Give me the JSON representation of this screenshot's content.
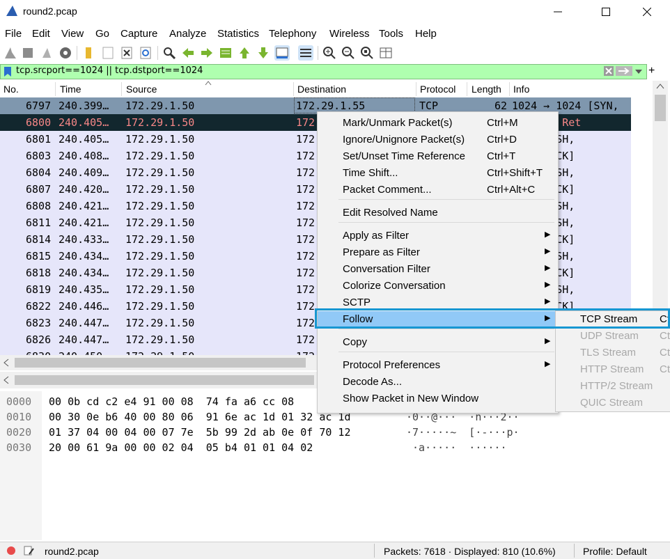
{
  "window": {
    "title": "round2.pcap"
  },
  "menu": [
    "File",
    "Edit",
    "View",
    "Go",
    "Capture",
    "Analyze",
    "Statistics",
    "Telephony",
    "Wireless",
    "Tools",
    "Help"
  ],
  "filter": {
    "value": "tcp.srcport==1024 || tcp.dstport==1024"
  },
  "columns": [
    "No.",
    "Time",
    "Source",
    "Destination",
    "Protocol",
    "Length",
    "Info"
  ],
  "packets": [
    {
      "no": "6797",
      "time": "240.399…",
      "src": "172.29.1.50",
      "dst": "172.29.1.55",
      "proto": "TCP",
      "len": "62",
      "info": "1024 → 1024 [SYN,"
    },
    {
      "no": "6800",
      "time": "240.405…",
      "src": "172.29.1.50",
      "dst": "172",
      "proto": "",
      "len": "",
      "info": "purious Ret"
    },
    {
      "no": "6801",
      "time": "240.405…",
      "src": "172.29.1.50",
      "dst": "172",
      "proto": "",
      "len": "",
      "info": "1024 [PSH,"
    },
    {
      "no": "6803",
      "time": "240.408…",
      "src": "172.29.1.50",
      "dst": "172",
      "proto": "",
      "len": "",
      "info": "1024 [ACK]"
    },
    {
      "no": "6804",
      "time": "240.409…",
      "src": "172.29.1.50",
      "dst": "172",
      "proto": "",
      "len": "",
      "info": "1024 [PSH,"
    },
    {
      "no": "6807",
      "time": "240.420…",
      "src": "172.29.1.50",
      "dst": "172",
      "proto": "",
      "len": "",
      "info": "1024 [ACK]"
    },
    {
      "no": "6808",
      "time": "240.421…",
      "src": "172.29.1.50",
      "dst": "172",
      "proto": "",
      "len": "",
      "info": "1024 [PSH,"
    },
    {
      "no": "6811",
      "time": "240.421…",
      "src": "172.29.1.50",
      "dst": "172",
      "proto": "",
      "len": "",
      "info": "1024 [PSH,"
    },
    {
      "no": "6814",
      "time": "240.433…",
      "src": "172.29.1.50",
      "dst": "172",
      "proto": "",
      "len": "",
      "info": "1024 [ACK]"
    },
    {
      "no": "6815",
      "time": "240.434…",
      "src": "172.29.1.50",
      "dst": "172",
      "proto": "",
      "len": "",
      "info": "1024 [PSH,"
    },
    {
      "no": "6818",
      "time": "240.434…",
      "src": "172.29.1.50",
      "dst": "172",
      "proto": "",
      "len": "",
      "info": "1024 [ACK]"
    },
    {
      "no": "6819",
      "time": "240.435…",
      "src": "172.29.1.50",
      "dst": "172",
      "proto": "",
      "len": "",
      "info": "1024 [PSH,"
    },
    {
      "no": "6822",
      "time": "240.446…",
      "src": "172.29.1.50",
      "dst": "172",
      "proto": "",
      "len": "",
      "info": "1024 [ACK]"
    },
    {
      "no": "6823",
      "time": "240.447…",
      "src": "172.29.1.50",
      "dst": "172",
      "proto": "",
      "len": "",
      "info": ""
    },
    {
      "no": "6826",
      "time": "240.447…",
      "src": "172.29.1.50",
      "dst": "172",
      "proto": "",
      "len": "",
      "info": ""
    },
    {
      "no": "6830",
      "time": "240.450…",
      "src": "172.29.1.50",
      "dst": "172",
      "proto": "",
      "len": "",
      "info": ""
    }
  ],
  "hex": [
    {
      "off": "0000",
      "bytes": "00 0b cd c2 e4 91 00 08  74 fa a6 cc 08",
      "ascii": ""
    },
    {
      "off": "0010",
      "bytes": "00 30 0e b6 40 00 80 06  91 6e ac 1d 01 32 ac 1d",
      "ascii": "·0··@···  ·n···2··"
    },
    {
      "off": "0020",
      "bytes": "01 37 04 00 04 00 07 7e  5b 99 2d ab 0e 0f 70 12",
      "ascii": "·7·····~  [·-···p·"
    },
    {
      "off": "0030",
      "bytes": "20 00 61 9a 00 00 02 04  05 b4 01 01 04 02",
      "ascii": " ·a·····  ······"
    }
  ],
  "context_menu": {
    "items": [
      {
        "label": "Mark/Unmark Packet(s)",
        "shortcut": "Ctrl+M"
      },
      {
        "label": "Ignore/Unignore Packet(s)",
        "shortcut": "Ctrl+D"
      },
      {
        "label": "Set/Unset Time Reference",
        "shortcut": "Ctrl+T"
      },
      {
        "label": "Time Shift...",
        "shortcut": "Ctrl+Shift+T"
      },
      {
        "label": "Packet Comment...",
        "shortcut": "Ctrl+Alt+C"
      },
      {
        "label": "Edit Resolved Name",
        "shortcut": ""
      },
      {
        "label": "Apply as Filter",
        "shortcut": ""
      },
      {
        "label": "Prepare as Filter",
        "shortcut": ""
      },
      {
        "label": "Conversation Filter",
        "shortcut": ""
      },
      {
        "label": "Colorize Conversation",
        "shortcut": ""
      },
      {
        "label": "SCTP",
        "shortcut": ""
      },
      {
        "label": "Follow",
        "shortcut": ""
      },
      {
        "label": "Copy",
        "shortcut": ""
      },
      {
        "label": "Protocol Preferences",
        "shortcut": ""
      },
      {
        "label": "Decode As...",
        "shortcut": ""
      },
      {
        "label": "Show Packet in New Window",
        "shortcut": ""
      }
    ]
  },
  "follow_submenu": [
    {
      "label": "TCP Stream",
      "shortcut": "Ct"
    },
    {
      "label": "UDP Stream",
      "shortcut": "Ct"
    },
    {
      "label": "TLS Stream",
      "shortcut": "Ct"
    },
    {
      "label": "HTTP Stream",
      "shortcut": "Ct"
    },
    {
      "label": "HTTP/2 Stream",
      "shortcut": ""
    },
    {
      "label": "QUIC Stream",
      "shortcut": ""
    }
  ],
  "status": {
    "file": "round2.pcap",
    "packets": "Packets: 7618 · Displayed: 810 (10.6%)",
    "profile": "Profile: Default"
  },
  "colors": {
    "row_light": "#e6e6fa",
    "row_selected": "#7f97ae",
    "row_dark": "#12272e",
    "row_dark_text": "#f78787",
    "highlight_border": "#1797d2",
    "menu_hover": "#91c9f7",
    "filter_bg": "#afffaf"
  }
}
